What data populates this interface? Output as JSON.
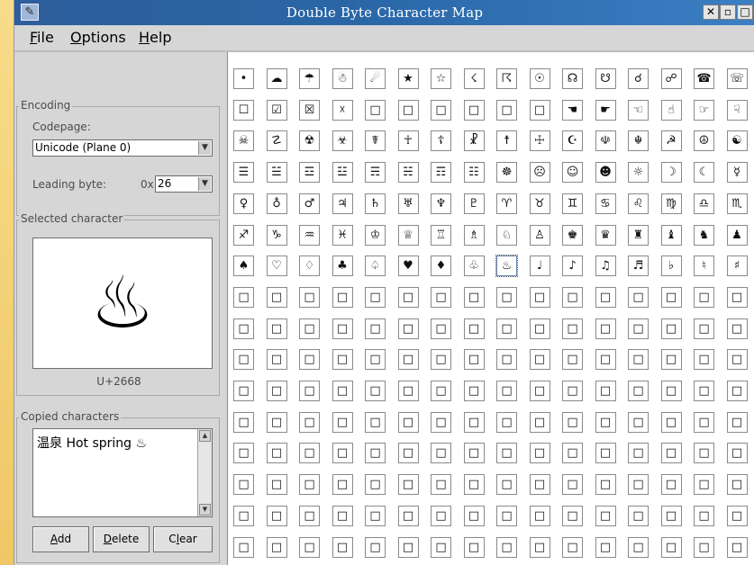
{
  "window": {
    "title": "Double Byte Character Map",
    "app_icon": "map-icon"
  },
  "titlebar_buttons": [
    "✕",
    "▫",
    "□"
  ],
  "menu": [
    {
      "pre": "",
      "u": "F",
      "post": "ile"
    },
    {
      "pre": "",
      "u": "O",
      "post": "ptions"
    },
    {
      "pre": "",
      "u": "H",
      "post": "elp"
    }
  ],
  "encoding": {
    "group_label": "Encoding",
    "codepage_label": "Codepage:",
    "codepage_value": "Unicode (Plane 0)",
    "leading_label": "Leading byte:",
    "leading_prefix": "0x",
    "leading_value": "26"
  },
  "selected": {
    "group_label": "Selected character",
    "glyph": "♨",
    "code": "U+2668"
  },
  "copied": {
    "group_label": "Copied characters",
    "text": "温泉 Hot spring ♨"
  },
  "buttons": [
    {
      "u": "A",
      "post": "dd"
    },
    {
      "u": "D",
      "post": "elete"
    },
    {
      "pre": "C",
      "u": "l",
      "post": "ear"
    }
  ],
  "grid": {
    "columns": 16,
    "rows": 16,
    "selected_index": 104,
    "chars": [
      "•",
      "☁",
      "☂",
      "☃",
      "☄",
      "★",
      "☆",
      "☇",
      "☈",
      "☉",
      "☊",
      "☋",
      "☌",
      "☍",
      "☎",
      "☏",
      "☐",
      "☑",
      "☒",
      "☓",
      "□",
      "□",
      "□",
      "□",
      "□",
      "□",
      "☚",
      "☛",
      "☜",
      "☝",
      "☞",
      "☟",
      "☠",
      "☡",
      "☢",
      "☣",
      "☤",
      "☥",
      "☦",
      "☧",
      "☨",
      "☩",
      "☪",
      "☫",
      "☬",
      "☭",
      "☮",
      "☯",
      "☰",
      "☱",
      "☲",
      "☳",
      "☴",
      "☵",
      "☶",
      "☷",
      "☸",
      "☹",
      "☺",
      "☻",
      "☼",
      "☽",
      "☾",
      "☿",
      "♀",
      "♁",
      "♂",
      "♃",
      "♄",
      "♅",
      "♆",
      "♇",
      "♈",
      "♉",
      "♊",
      "♋",
      "♌",
      "♍",
      "♎",
      "♏",
      "♐",
      "♑",
      "♒",
      "♓",
      "♔",
      "♕",
      "♖",
      "♗",
      "♘",
      "♙",
      "♚",
      "♛",
      "♜",
      "♝",
      "♞",
      "♟",
      "♠",
      "♡",
      "♢",
      "♣",
      "♤",
      "♥",
      "♦",
      "♧",
      "♨",
      "♩",
      "♪",
      "♫",
      "♬",
      "♭",
      "♮",
      "♯",
      "□",
      "□",
      "□",
      "□",
      "□",
      "□",
      "□",
      "□",
      "□",
      "□",
      "□",
      "□",
      "□",
      "□",
      "□",
      "□",
      "□",
      "□",
      "□",
      "□",
      "□",
      "□",
      "□",
      "□",
      "□",
      "□",
      "□",
      "□",
      "□",
      "□",
      "□",
      "□",
      "□",
      "□",
      "□",
      "□",
      "□",
      "□",
      "□",
      "□",
      "□",
      "□",
      "□",
      "□",
      "□",
      "□",
      "□",
      "□",
      "□",
      "□",
      "□",
      "□",
      "□",
      "□",
      "□",
      "□",
      "□",
      "□",
      "□",
      "□",
      "□",
      "□",
      "□",
      "□",
      "□",
      "□",
      "□",
      "□",
      "□",
      "□",
      "□",
      "□",
      "□",
      "□",
      "□",
      "□",
      "□",
      "□",
      "□",
      "□",
      "□",
      "□",
      "□",
      "□",
      "□",
      "□",
      "□",
      "□",
      "□",
      "□",
      "□",
      "□",
      "□",
      "□",
      "□",
      "□",
      "□",
      "□",
      "□",
      "□",
      "□",
      "□",
      "□",
      "□",
      "□",
      "□",
      "□",
      "□",
      "□",
      "□",
      "□",
      "□",
      "□",
      "□",
      "□",
      "□",
      "□",
      "□",
      "□",
      "□",
      "□",
      "□",
      "□",
      "□",
      "□",
      "□",
      "□",
      "□",
      "□",
      "□",
      "□",
      "□",
      "□",
      "□",
      "□",
      "□",
      "□",
      "□",
      "□",
      "□",
      "□",
      "□",
      "□",
      "□"
    ]
  }
}
